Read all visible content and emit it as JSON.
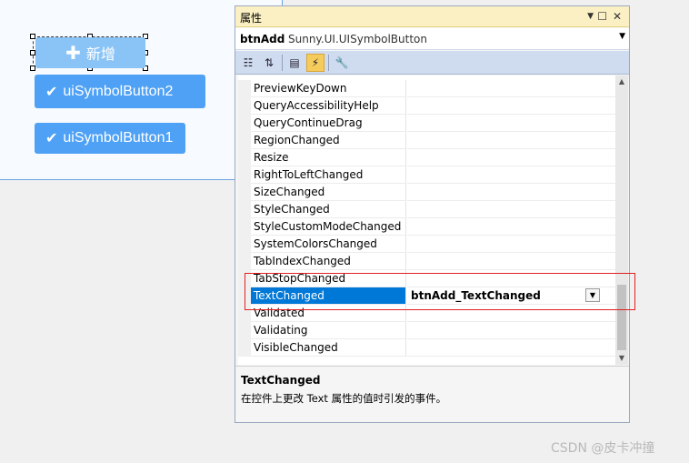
{
  "designer": {
    "buttons": [
      {
        "icon": "plus-icon",
        "label": "新增"
      },
      {
        "icon": "check-icon",
        "label": "uiSymbolButton2"
      },
      {
        "icon": "check-icon",
        "label": "uiSymbolButton1"
      }
    ]
  },
  "properties": {
    "title": "属性",
    "object_name": "btnAdd",
    "object_type": "Sunny.UI.UISymbolButton",
    "toolbar": [
      "categorized-icon",
      "alphabetical-icon",
      "properties-icon",
      "events-icon",
      "property-pages-icon"
    ],
    "rows": [
      {
        "name": "PreviewKeyDown",
        "value": ""
      },
      {
        "name": "QueryAccessibilityHelp",
        "value": ""
      },
      {
        "name": "QueryContinueDrag",
        "value": ""
      },
      {
        "name": "RegionChanged",
        "value": ""
      },
      {
        "name": "Resize",
        "value": ""
      },
      {
        "name": "RightToLeftChanged",
        "value": ""
      },
      {
        "name": "SizeChanged",
        "value": ""
      },
      {
        "name": "StyleChanged",
        "value": ""
      },
      {
        "name": "StyleCustomModeChanged",
        "value": ""
      },
      {
        "name": "SystemColorsChanged",
        "value": ""
      },
      {
        "name": "TabIndexChanged",
        "value": ""
      },
      {
        "name": "TabStopChanged",
        "value": ""
      },
      {
        "name": "TextChanged",
        "value": "btnAdd_TextChanged"
      },
      {
        "name": "Validated",
        "value": ""
      },
      {
        "name": "Validating",
        "value": ""
      },
      {
        "name": "VisibleChanged",
        "value": ""
      }
    ],
    "selected_index": 12,
    "description_title": "TextChanged",
    "description_text": "在控件上更改 Text 属性的值时引发的事件。"
  },
  "watermark": "CSDN @皮卡冲撞",
  "colors": {
    "accent": "#4ea1f5",
    "selection": "#0078d7",
    "highlight": "#e02020"
  }
}
